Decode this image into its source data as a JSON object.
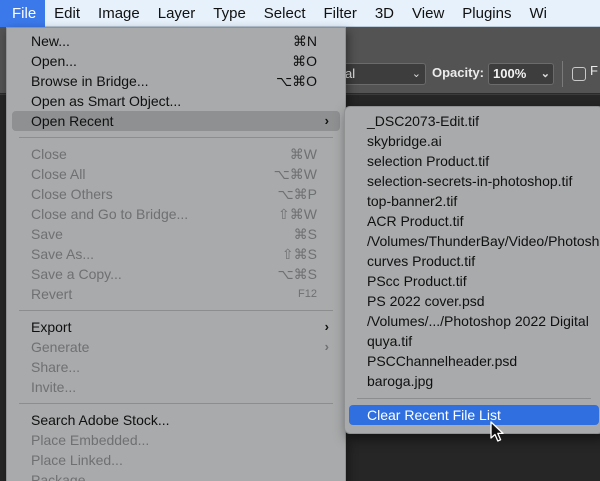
{
  "menubar": {
    "items": [
      "File",
      "Edit",
      "Image",
      "Layer",
      "Type",
      "Select",
      "Filter",
      "3D",
      "View",
      "Plugins",
      "Wi"
    ]
  },
  "options_bar": {
    "mode_value": "al",
    "opacity_label": "Opacity:",
    "opacity_value": "100%",
    "right_text": "F"
  },
  "file_menu": {
    "new": {
      "label": "New...",
      "shortcut": "⌘N"
    },
    "open": {
      "label": "Open...",
      "shortcut": "⌘O"
    },
    "browse": {
      "label": "Browse in Bridge...",
      "shortcut": "⌥⌘O"
    },
    "open_smart": {
      "label": "Open as Smart Object..."
    },
    "open_recent": {
      "label": "Open Recent",
      "arrow": "›"
    },
    "close": {
      "label": "Close",
      "shortcut": "⌘W"
    },
    "close_all": {
      "label": "Close All",
      "shortcut": "⌥⌘W"
    },
    "close_others": {
      "label": "Close Others",
      "shortcut": "⌥⌘P"
    },
    "close_bridge": {
      "label": "Close and Go to Bridge...",
      "shortcut": "⇧⌘W"
    },
    "save": {
      "label": "Save",
      "shortcut": "⌘S"
    },
    "save_as": {
      "label": "Save As...",
      "shortcut": "⇧⌘S"
    },
    "save_copy": {
      "label": "Save a Copy...",
      "shortcut": "⌥⌘S"
    },
    "revert": {
      "label": "Revert",
      "shortcut": "F12"
    },
    "export": {
      "label": "Export",
      "arrow": "›"
    },
    "generate": {
      "label": "Generate",
      "arrow": "›"
    },
    "share": {
      "label": "Share..."
    },
    "invite": {
      "label": "Invite..."
    },
    "search_stock": {
      "label": "Search Adobe Stock..."
    },
    "place_embedded": {
      "label": "Place Embedded..."
    },
    "place_linked": {
      "label": "Place Linked..."
    },
    "package": {
      "label": "Package..."
    }
  },
  "recent_menu": {
    "files": [
      "_DSC2073-Edit.tif",
      "skybridge.ai",
      "selection Product.tif",
      "selection-secrets-in-photoshop.tif",
      "top-banner2.tif",
      "ACR Product.tif",
      "/Volumes/ThunderBay/Video/Photoshop",
      "curves Product.tif",
      "PScc Product.tif",
      "PS 2022 cover.psd",
      "/Volumes/.../Photoshop 2022 Digital",
      "quya.tif",
      "PSCChannelheader.psd",
      "baroga.jpg"
    ],
    "clear_label": "Clear Recent File List"
  },
  "colors": {
    "menubar_bg": "#e6f1fb",
    "active_menu": "#3b78ea",
    "menu_bg": "#a8aaab",
    "highlight_row": "#8e9091",
    "selected_row": "#2f6fe0"
  }
}
